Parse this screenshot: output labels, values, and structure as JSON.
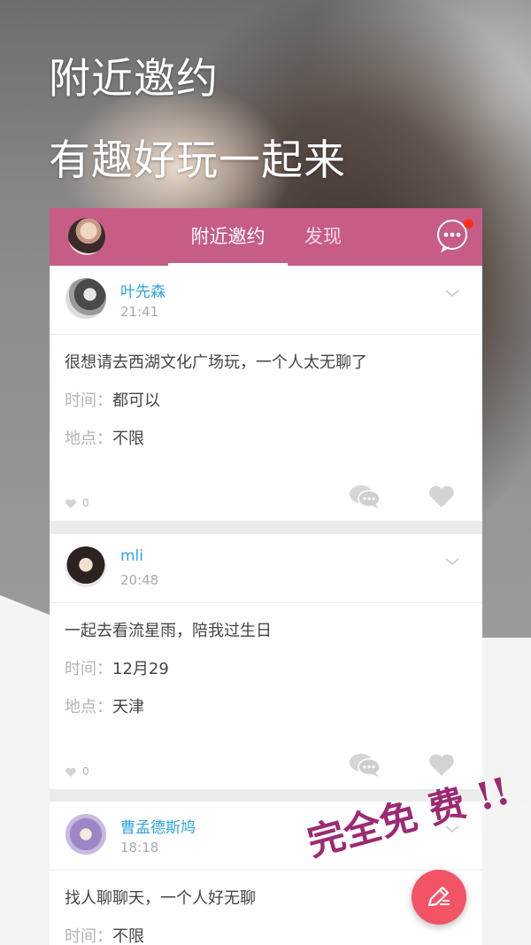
{
  "headline": {
    "line1": "附近邀约",
    "line2": "有趣好玩一起来"
  },
  "appbar": {
    "tabs": [
      {
        "label": "附近邀约",
        "active": true
      },
      {
        "label": "发现",
        "active": false
      }
    ],
    "message_icon": "chat-bubble-dots-icon",
    "has_notification": true
  },
  "posts": [
    {
      "user": "叶先森",
      "time": "21:41",
      "content": "很想请去西湖文化广场玩，一个人太无聊了",
      "time_label": "时间：",
      "time_value": "都可以",
      "place_label": "地点：",
      "place_value": "不限",
      "likes": "0"
    },
    {
      "user": "mli",
      "time": "20:48",
      "content": "一起去看流星雨，陪我过生日",
      "time_label": "时间：",
      "time_value": "12月29",
      "place_label": "地点：",
      "place_value": "天津",
      "likes": "0"
    },
    {
      "user": "曹孟德斯鸠",
      "time": "18:18",
      "content": "找人聊聊天，一个人好无聊",
      "time_label": "时间：",
      "time_value": "不限"
    }
  ],
  "promo": "完全免 费 !!",
  "colors": {
    "appbar": "#c75c86",
    "username": "#2ea4e0",
    "fab": "#f25465",
    "promo": "#9c2a73"
  }
}
